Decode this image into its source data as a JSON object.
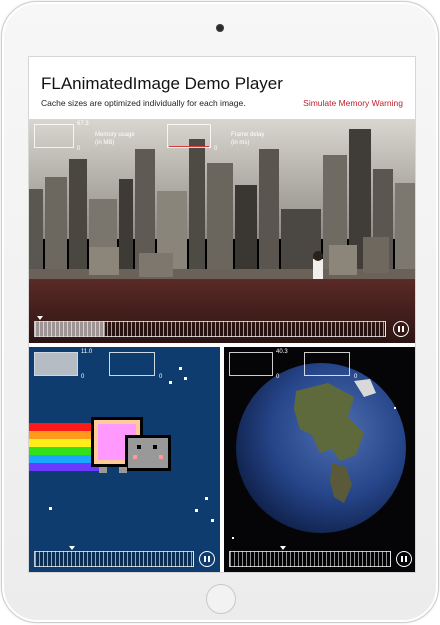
{
  "header": {
    "title": "FLAnimatedImage Demo Player",
    "subtitle": "Cache sizes are optimized individually for each image.",
    "memory_warning_label": "Simulate Memory Warning"
  },
  "players": {
    "main": {
      "memory_value": "67.3",
      "memory_zero": "0",
      "memory_label_line1": "Memory usage",
      "memory_label_line2": "(in MB)",
      "frame_zero": "0",
      "frame_label_line1": "Frame delay",
      "frame_label_line2": "(in ms)",
      "memory_fill": 0.0,
      "progress": 0.2
    },
    "cat": {
      "memory_value": "11.0",
      "memory_zero": "0",
      "frame_zero": "0",
      "memory_fill": 1.0,
      "progress": 0.35
    },
    "earth": {
      "memory_value": "40.3",
      "memory_zero": "0",
      "frame_zero": "0",
      "memory_fill": 0.0,
      "progress": 0.45
    }
  },
  "colors": {
    "warning": "#c0202a",
    "frame_delay_line": "#d83838"
  },
  "icons": [
    "pause-icon",
    "camera",
    "home-button"
  ]
}
